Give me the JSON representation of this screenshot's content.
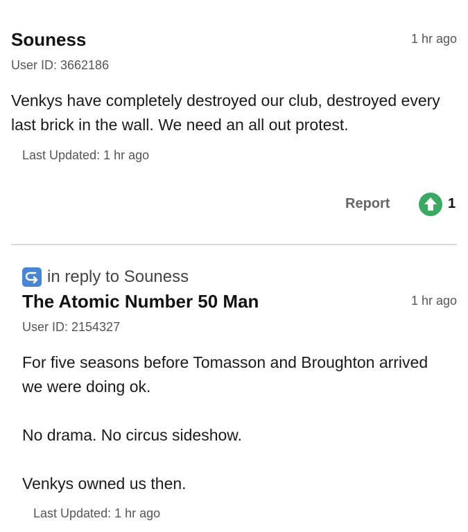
{
  "comments": [
    {
      "author": "Souness",
      "time": "1 hr ago",
      "user_id": "User ID: 3662186",
      "body": [
        "Venkys have completely destroyed our club, destroyed every last brick in the wall. We need an all out protest."
      ],
      "updated": "Last Updated: 1 hr ago",
      "report_label": "Report",
      "votes": "1"
    },
    {
      "reply_to": "in reply to Souness",
      "author": "The Atomic Number 50 Man",
      "time": "1 hr ago",
      "user_id": "User ID: 2154327",
      "body": [
        "For five seasons before Tomasson and Broughton arrived we were doing ok.",
        "No drama. No circus sideshow.",
        "Venkys owned us then."
      ],
      "updated": "Last Updated: 1 hr ago"
    }
  ],
  "colors": {
    "upvote": "#3ba863",
    "reply_icon": "#4a86cf",
    "divider": "#d6d6d6"
  },
  "icons": {
    "upvote": "arrow-up-icon",
    "reply": "reply-arrow-icon"
  }
}
